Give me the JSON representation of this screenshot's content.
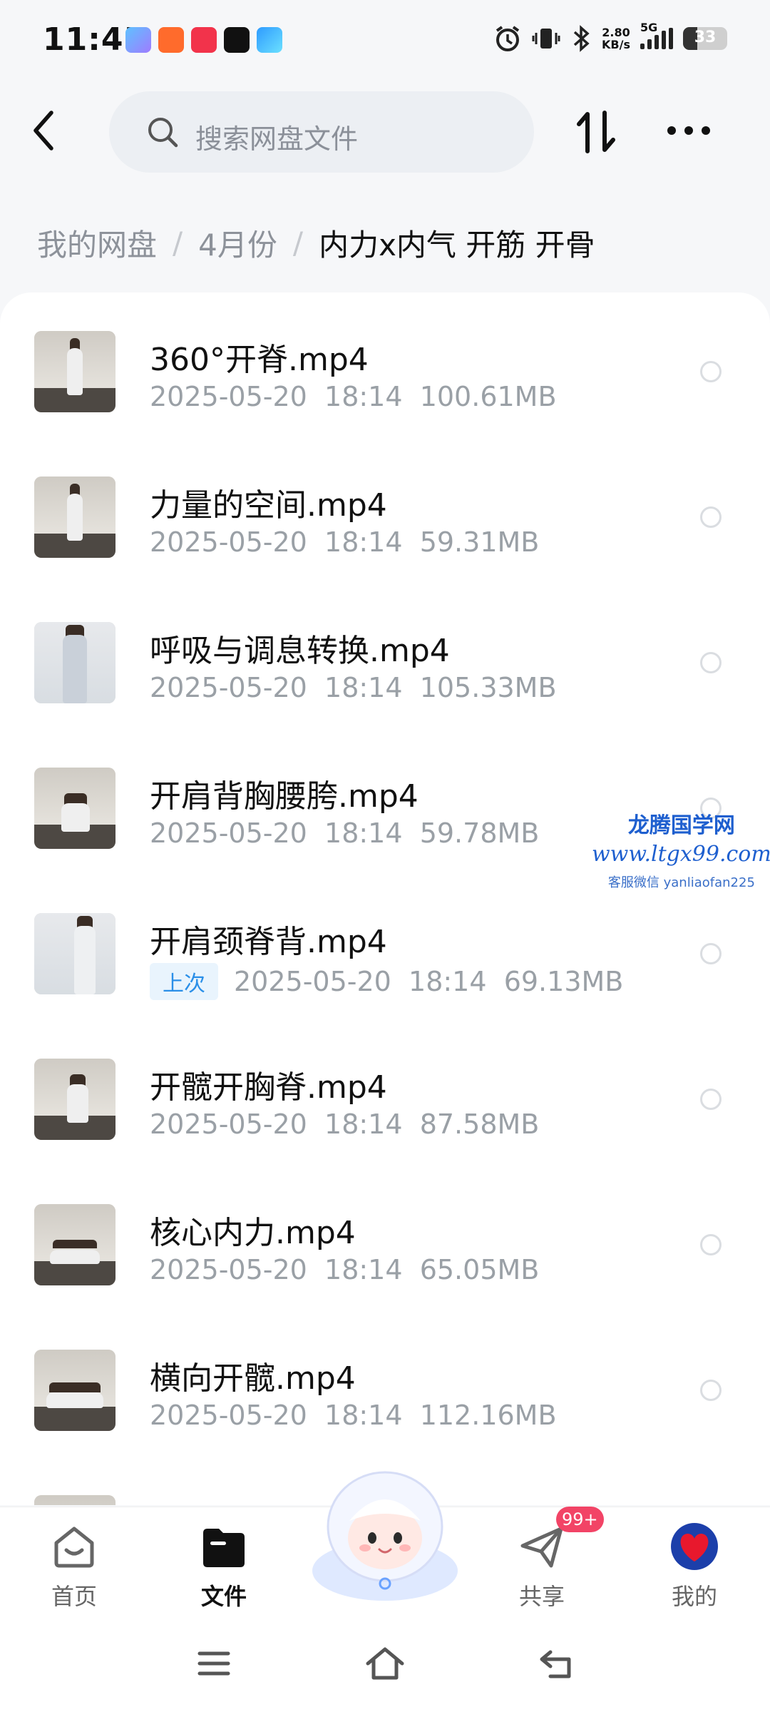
{
  "status_bar": {
    "time": "11:45",
    "net_speed_value": "2.80",
    "net_speed_unit": "KB/s",
    "network_type": "5G",
    "battery_level": "33",
    "icons": [
      "alarm-icon",
      "vibrate-icon",
      "bluetooth-icon",
      "signal-icon",
      "battery-icon"
    ]
  },
  "header": {
    "search_placeholder": "搜索网盘文件",
    "icons": [
      "back-arrow-icon",
      "search-icon",
      "sort-icon",
      "more-icon"
    ]
  },
  "breadcrumb": {
    "items": [
      "我的网盘",
      "4月份"
    ],
    "current": "内力x内气 开筋 开骨"
  },
  "files": [
    {
      "name": "360°开脊.mp4",
      "date": "2025-05-20",
      "time": "18:14",
      "size": "100.61MB"
    },
    {
      "name": "力量的空间.mp4",
      "date": "2025-05-20",
      "time": "18:14",
      "size": "59.31MB"
    },
    {
      "name": "呼吸与调息转换.mp4",
      "date": "2025-05-20",
      "time": "18:14",
      "size": "105.33MB"
    },
    {
      "name": "开肩背胸腰胯.mp4",
      "date": "2025-05-20",
      "time": "18:14",
      "size": "59.78MB"
    },
    {
      "name": "开肩颈脊背.mp4",
      "tag": "上次",
      "date": "2025-05-20",
      "time": "18:14",
      "size": "69.13MB"
    },
    {
      "name": "开髋开胸脊.mp4",
      "date": "2025-05-20",
      "time": "18:14",
      "size": "87.58MB"
    },
    {
      "name": "核心内力.mp4",
      "date": "2025-05-20",
      "time": "18:14",
      "size": "65.05MB"
    },
    {
      "name": "横向开髋.mp4",
      "date": "2025-05-20",
      "time": "18:14",
      "size": "112.16MB"
    }
  ],
  "watermark": {
    "line1": "龙腾国学网",
    "line2": "www.ltgx99.com",
    "line3": "客服微信 yanliaofan225"
  },
  "bottom_nav": {
    "items": [
      {
        "label": "首页",
        "icon": "home-icon",
        "active": false
      },
      {
        "label": "文件",
        "icon": "folder-icon",
        "active": true
      },
      {
        "label": "共享",
        "icon": "send-icon",
        "active": false
      },
      {
        "label": "我的",
        "icon": "heart-avatar-icon",
        "active": false
      }
    ],
    "share_badge": "99+"
  },
  "colors": {
    "accent": "#2a8fe8",
    "badge": "#f24466",
    "text_primary": "#111111",
    "text_secondary": "#9aa0a6"
  }
}
